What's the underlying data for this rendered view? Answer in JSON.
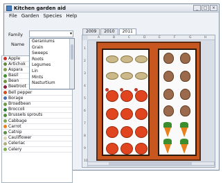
{
  "window": {
    "title": "Kitchen garden aid"
  },
  "menu": [
    "File",
    "Garden",
    "Species",
    "Help"
  ],
  "controls": {
    "minimize": "_",
    "maximize": "□",
    "close": "×"
  },
  "family": {
    "label": "Family",
    "value": ""
  },
  "name": {
    "label": "Name"
  },
  "family_dropdown": [
    "Geraniums",
    "Grain",
    "Sweeps",
    "Roots",
    "Legumes",
    "Lin",
    "Mints",
    "Nasturtium"
  ],
  "plants": [
    {
      "label": "Apple",
      "color": "#c8322b"
    },
    {
      "label": "Artichok",
      "color": "#5e8c3a"
    },
    {
      "label": "Aspara",
      "color": "#7fa342"
    },
    {
      "label": "Basil",
      "color": "#3f8f2e"
    },
    {
      "label": "Bean",
      "color": "#6a9a36"
    },
    {
      "label": "Beetroot",
      "color": "#8a1f3a"
    },
    {
      "label": "Bell pepper",
      "color": "#d64a1c"
    },
    {
      "label": "Borage",
      "color": "#4a6fb5"
    },
    {
      "label": "Broadbean",
      "color": "#6f9a44"
    },
    {
      "label": "Broccoli",
      "color": "#2f7d32"
    },
    {
      "label": "Brussels sprouts",
      "color": "#4f8f3a"
    },
    {
      "label": "Cabbage",
      "color": "#7daa55"
    },
    {
      "label": "Carrot",
      "color": "#e8801d"
    },
    {
      "label": "Catnip",
      "color": "#5c8f4a"
    },
    {
      "label": "Cauliflower",
      "color": "#d9d4b8"
    },
    {
      "label": "Celeriac",
      "color": "#b3ae7a"
    },
    {
      "label": "Celery",
      "color": "#7fb04a"
    }
  ],
  "tabs": [
    "2009",
    "2010",
    "2011"
  ],
  "active_tab": "2011",
  "ruler_top": [
    "A",
    "B",
    "C",
    "D",
    "E",
    "F",
    "G",
    "H"
  ],
  "ruler_left": [
    "1",
    "2",
    "3",
    "4",
    "5",
    "6",
    "7",
    "8",
    "9",
    "10"
  ]
}
